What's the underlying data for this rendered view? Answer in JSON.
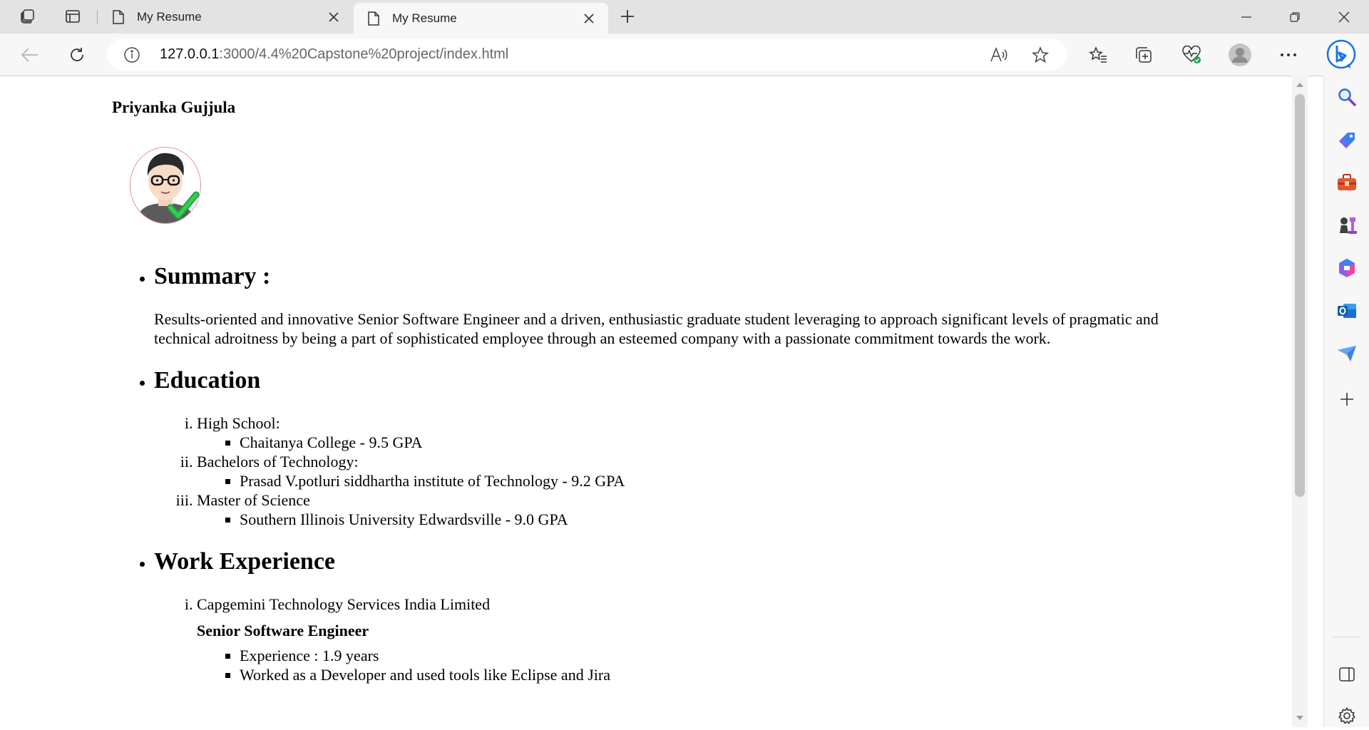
{
  "browser": {
    "tabs": [
      {
        "title": "My Resume",
        "active": false
      },
      {
        "title": "My Resume",
        "active": true
      }
    ],
    "url_host": "127.0.0.1",
    "url_rest": ":3000/4.4%20Capstone%20project/index.html"
  },
  "resume": {
    "name": "Priyanka Gujjula",
    "summary": {
      "heading": "Summary :",
      "text": "Results-oriented and innovative Senior Software Engineer and a driven, enthusiastic graduate student leveraging to approach significant levels of pragmatic and technical adroitness by being a part of sophisticated employee through an esteemed company with a passionate commitment towards the work."
    },
    "education": {
      "heading": "Education",
      "items": [
        {
          "level": "High School:",
          "detail": "Chaitanya College - 9.5 GPA"
        },
        {
          "level": "Bachelors of Technology:",
          "detail": "Prasad V.potluri siddhartha institute of Technology - 9.2 GPA"
        },
        {
          "level": "Master of Science",
          "detail": "Southern Illinois University Edwardsville - 9.0 GPA"
        }
      ]
    },
    "work": {
      "heading": "Work Experience",
      "items": [
        {
          "company": "Capgemini Technology Services India Limited",
          "role": "Senior Software Engineer",
          "points": [
            "Experience : 1.9 years",
            "Worked as a Developer and used tools like Eclipse and Jira"
          ]
        }
      ]
    }
  }
}
